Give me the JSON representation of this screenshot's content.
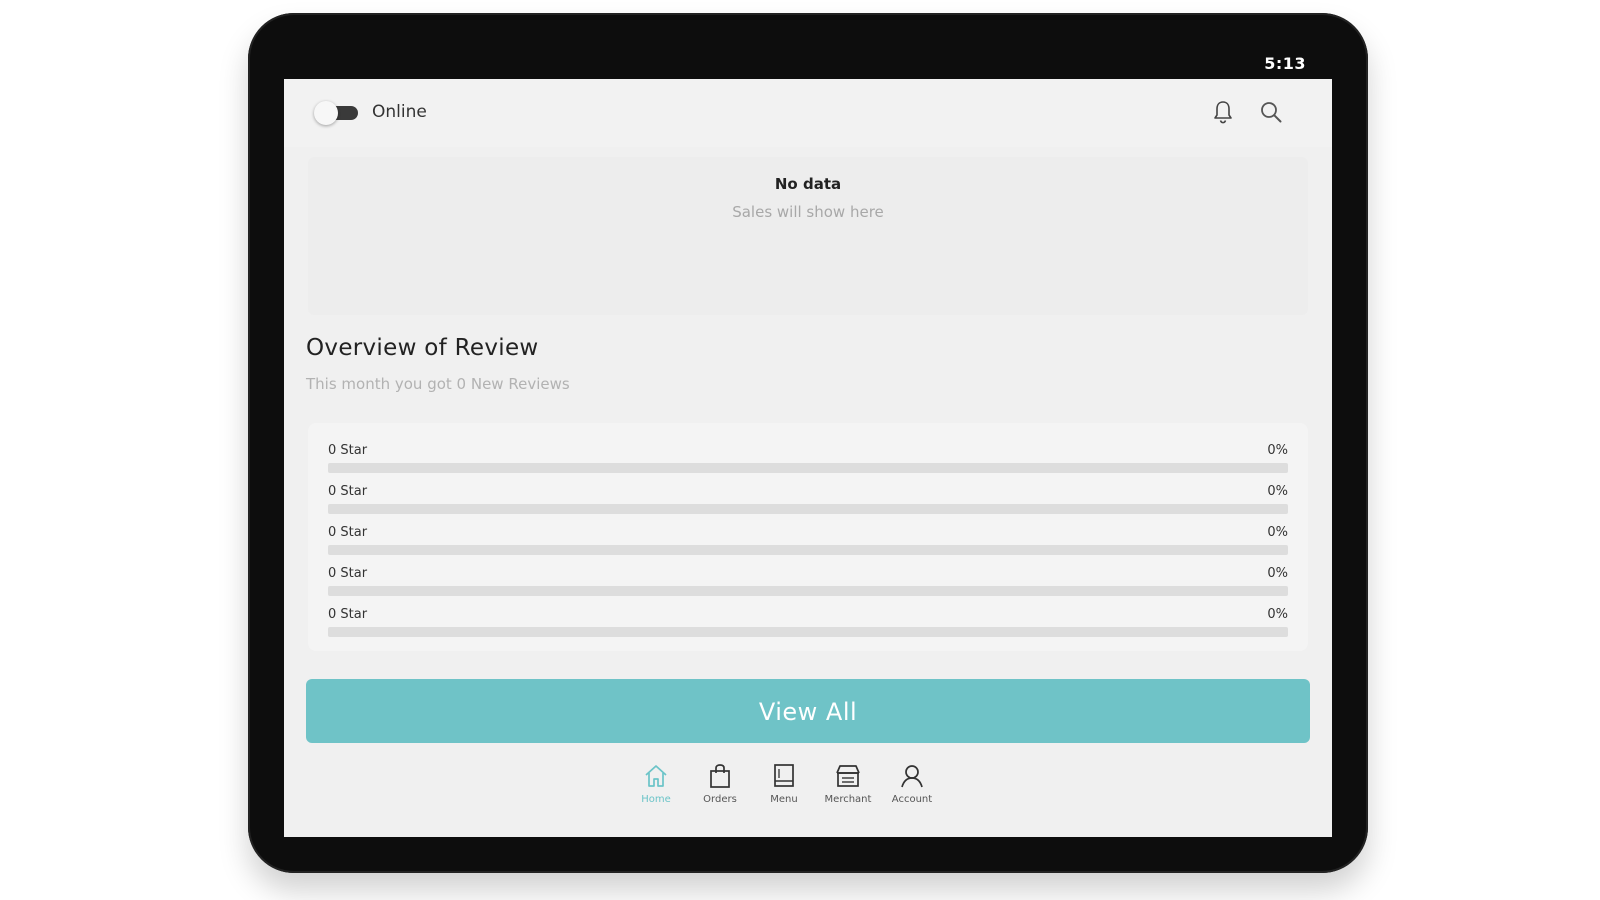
{
  "status_bar": {
    "time": "5:13"
  },
  "header": {
    "toggle_label": "Online",
    "online": false,
    "icons": [
      "bell-icon",
      "search-icon"
    ]
  },
  "sales": {
    "title": "No data",
    "hint": "Sales will show here"
  },
  "review_overview": {
    "title": "Overview of Review",
    "subtitle": "This month you got 0 New Reviews",
    "rows": [
      {
        "label": "0 Star",
        "percent_text": "0%",
        "percent": 0
      },
      {
        "label": "0 Star",
        "percent_text": "0%",
        "percent": 0
      },
      {
        "label": "0 Star",
        "percent_text": "0%",
        "percent": 0
      },
      {
        "label": "0 Star",
        "percent_text": "0%",
        "percent": 0
      },
      {
        "label": "0 Star",
        "percent_text": "0%",
        "percent": 0
      }
    ],
    "view_all_label": "View All"
  },
  "nav": {
    "items": [
      {
        "label": "Home",
        "icon": "home-icon",
        "active": true
      },
      {
        "label": "Orders",
        "icon": "bag-icon",
        "active": false
      },
      {
        "label": "Menu",
        "icon": "menu-book-icon",
        "active": false
      },
      {
        "label": "Merchant",
        "icon": "store-icon",
        "active": false
      },
      {
        "label": "Account",
        "icon": "account-icon",
        "active": false
      }
    ]
  },
  "colors": {
    "accent": "#6fc3c7",
    "device_frame": "#0d0d0d",
    "screen_bg": "#f0f0f0",
    "bar_track": "#dddddd"
  }
}
